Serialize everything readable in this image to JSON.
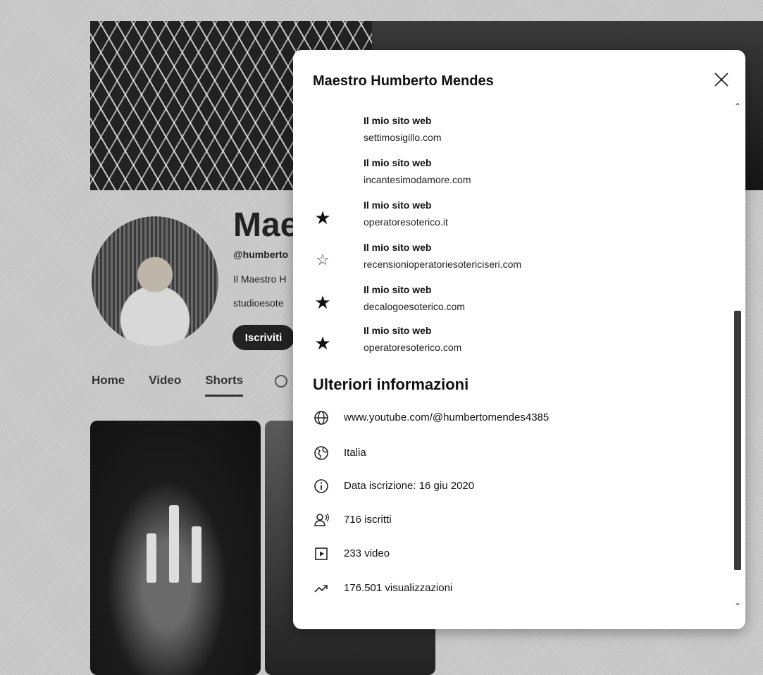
{
  "channel_page": {
    "title_partial": "Maes",
    "handle_partial": "@humberto",
    "description_partial": "Il Maestro H",
    "link_partial": "studioesote",
    "subscribe_label": "Iscriviti",
    "tabs": [
      {
        "label": "Home"
      },
      {
        "label": "Video"
      },
      {
        "label": "Shorts",
        "active": true
      }
    ]
  },
  "modal": {
    "title": "Maestro Humberto Mendes",
    "links": [
      {
        "title": "Il mio sito web",
        "url": "settimosigillo.com",
        "icon": "none"
      },
      {
        "title": "Il mio sito web",
        "url": "incantesimodamore.com",
        "icon": "none"
      },
      {
        "title": "Il mio sito web",
        "url": "operatoresoterico.it",
        "icon": "star-icon"
      },
      {
        "title": "Il mio sito web",
        "url": "recensionioperatoriesotericiseri.com",
        "icon": "star-outline-icon"
      },
      {
        "title": "Il mio sito web",
        "url": "decalogoesoterico.com",
        "icon": "star-icon"
      },
      {
        "title": "Il mio sito web",
        "url": "operatoresoterico.com",
        "icon": "star-icon"
      }
    ],
    "more_info_title": "Ulteriori informazioni",
    "info": {
      "url": "www.youtube.com/@humbertomendes4385",
      "country": "Italia",
      "joined": "Data iscrizione: 16 giu 2020",
      "subscribers": "716 iscritti",
      "videos": "233 video",
      "views": "176.501 visualizzazioni"
    }
  },
  "colors": {
    "modal_bg": "#ffffff",
    "backdrop": "#cfcfcf",
    "button_dark": "#222222"
  }
}
